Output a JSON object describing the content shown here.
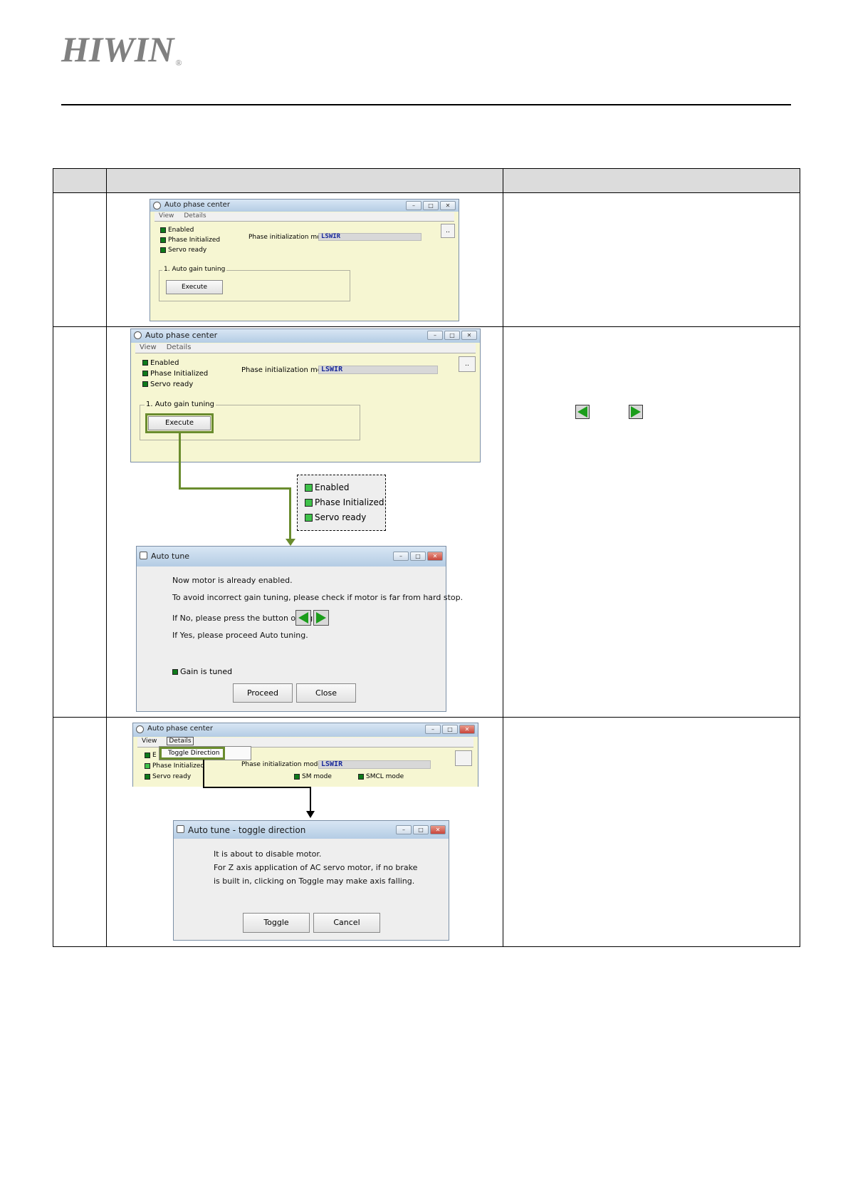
{
  "brand": {
    "logo_text": "HIWIN",
    "logo_mark": "®"
  },
  "step1": {
    "window": {
      "title": "Auto phase center",
      "menu": [
        "View",
        "Details"
      ]
    },
    "status": [
      "Enabled",
      "Phase Initialized",
      "Servo ready"
    ],
    "mode_label": "Phase initialization mode:",
    "mode_value": "LSWIR",
    "side_button": "..",
    "group_label": "1. Auto gain tuning",
    "execute": "Execute"
  },
  "step2": {
    "window": {
      "title": "Auto phase center",
      "menu": [
        "View",
        "Details"
      ]
    },
    "status": [
      "Enabled",
      "Phase Initialized",
      "Servo ready"
    ],
    "mode_label": "Phase initialization mode:",
    "mode_value": "LSWIR",
    "side_button": "..",
    "group_label": "1. Auto gain tuning",
    "execute": "Execute",
    "callout_status": [
      "Enabled",
      "Phase Initialized",
      "Servo ready"
    ],
    "dialog": {
      "title": "Auto tune",
      "lines": [
        "Now motor is already enabled.",
        "To avoid incorrect gain tuning, please check if motor is far from hard stop.",
        "If No, please press the button of jog.",
        "If Yes, please proceed Auto tuning."
      ],
      "gain_label": "Gain is tuned",
      "proceed": "Proceed",
      "close": "Close"
    }
  },
  "step3": {
    "window": {
      "title": "Auto phase center",
      "menu": [
        "View",
        "Details"
      ]
    },
    "menu_item": "Toggle Direction",
    "status": [
      "E",
      "Phase Initialized",
      "Servo ready"
    ],
    "mode_label": "Phase initialization mode:",
    "mode_value": "LSWIR",
    "sm_mode": "SM mode",
    "smcl_mode": "SMCL mode",
    "dialog": {
      "title": "Auto tune - toggle direction",
      "lines": [
        "It is about to disable motor.",
        "For Z axis application of AC servo motor, if no brake",
        "is built in, clicking on Toggle may make axis falling."
      ],
      "toggle": "Toggle",
      "cancel": "Cancel"
    }
  },
  "colors": {
    "highlight": "#6a8c2e",
    "led": "#0e7a1a",
    "window_bg": "#f6f6d2"
  }
}
